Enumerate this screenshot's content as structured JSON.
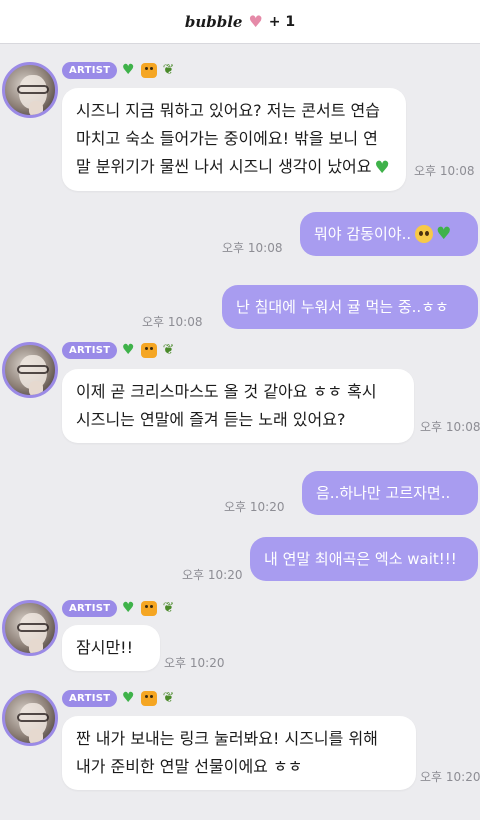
{
  "header": {
    "brand": "bubble",
    "heart": "♥",
    "plus": "+ 1"
  },
  "artist_badge": "ARTIST",
  "badge_icons": [
    "green-heart",
    "tiger",
    "sprout"
  ],
  "messages": [
    {
      "from": "artist",
      "lines": [
        "시즈니 지금 뭐하고 있어요? 저는 콘서트 연습",
        "마치고 숙소 들어가는 중이에요! 밖을 보니 연",
        "말 분위기가 물씬 나서 시즈니 생각이 났어요"
      ],
      "time": "오후 10:08"
    },
    {
      "from": "me",
      "text": "뭐야 감동이야..",
      "time": "오후 10:08"
    },
    {
      "from": "me",
      "text": "난 침대에 누워서 귤 먹는 중..ㅎㅎ",
      "time": "오후 10:08"
    },
    {
      "from": "artist",
      "lines": [
        "이제 곧 크리스마스도 올 것 같아요 ㅎㅎ 혹시",
        "시즈니는 연말에 즐겨 듣는 노래 있어요?"
      ],
      "time": "오후 10:08"
    },
    {
      "from": "me",
      "text": "음..하나만 고르자면..",
      "time": "오후 10:20"
    },
    {
      "from": "me",
      "text": "내 연말 최애곡은 엑소 wait!!!",
      "time": "오후 10:20"
    },
    {
      "from": "artist",
      "lines": [
        "잠시만!!"
      ],
      "time": "오후 10:20"
    },
    {
      "from": "artist",
      "lines": [
        "짠 내가 보내는 링크 눌러봐요! 시즈니를 위해",
        "내가 준비한 연말 선물이에요 ㅎㅎ"
      ],
      "time": "오후 10:20"
    }
  ],
  "colors": {
    "background": "#ececef",
    "outgoing_bubble": "#a89cf0",
    "artist_badge": "#9a8be8",
    "avatar_ring": "#9b8ae6"
  }
}
